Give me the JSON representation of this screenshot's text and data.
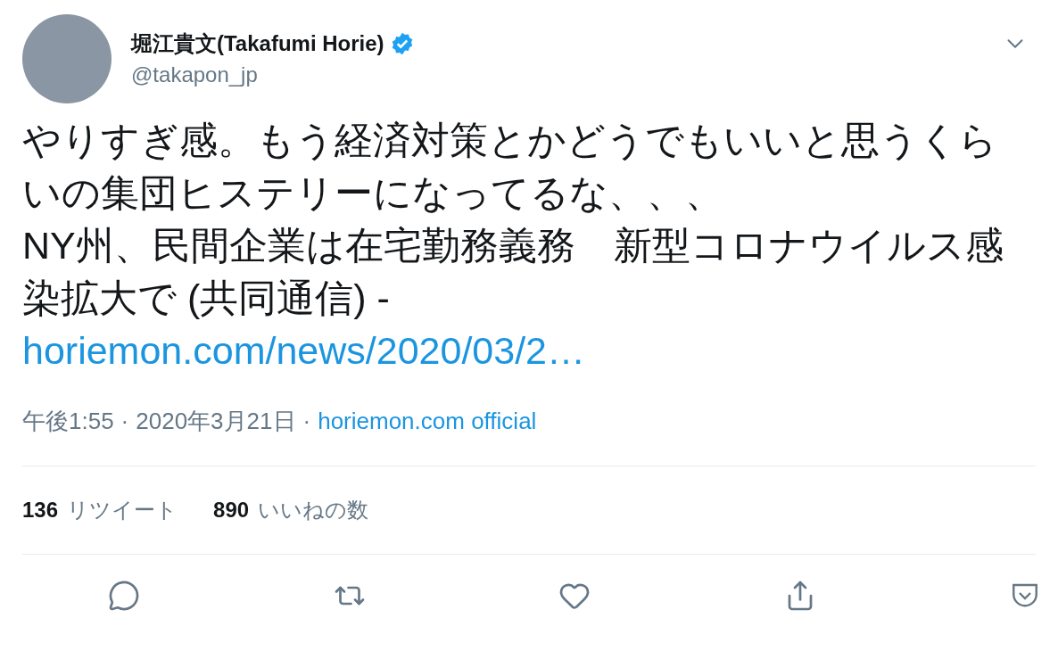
{
  "author": {
    "name": "堀江貴文(Takafumi Horie)",
    "verified": true,
    "handle": "@takapon_jp"
  },
  "body": {
    "text": "やりすぎ感。もう経済対策とかどうでもいいと思うくらいの集団ヒステリーになってるな、、、\nNY州、民間企業は在宅勤務義務　新型コロナウイルス感染拡大で (共同通信) -\n",
    "link": "horiemon.com/news/2020/03/2…"
  },
  "meta": {
    "time": "午後1:55",
    "separator": "·",
    "date": "2020年3月21日",
    "source": "horiemon.com official"
  },
  "stats": [
    {
      "count": "136",
      "label": "リツイート"
    },
    {
      "count": "890",
      "label": "いいねの数"
    }
  ]
}
